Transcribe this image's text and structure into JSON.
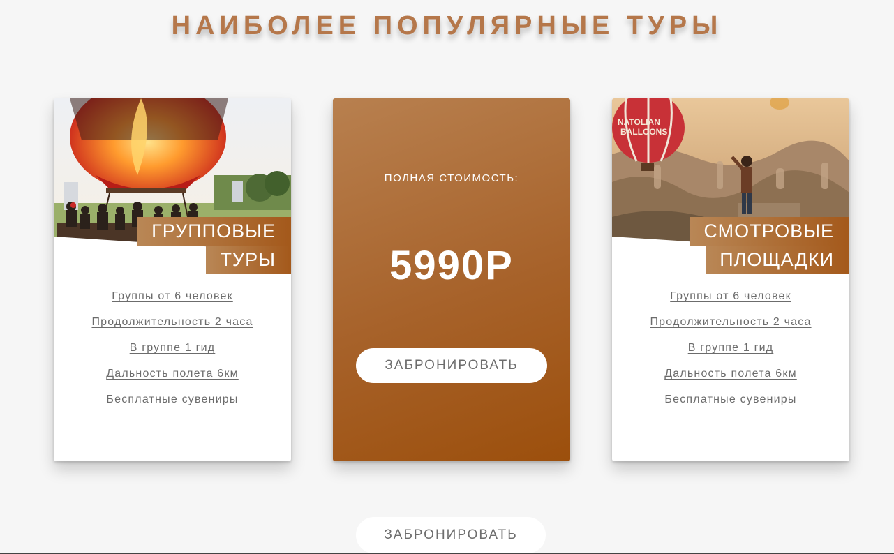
{
  "section": {
    "title": "НАИБОЛЕЕ ПОПУЛЯРНЫЕ ТУРЫ"
  },
  "cards": [
    {
      "label_line1": "ГРУППОВЫЕ",
      "label_line2": "ТУРЫ",
      "features": [
        "Группы от 6 человек",
        "Продолжительность 2 часа",
        "В группе 1 гид",
        "Дальность полета 6км",
        "Бесплатные сувениры"
      ]
    },
    {
      "price_caption": "ПОЛНАЯ СТОИМОСТЬ:",
      "price": "5990Р",
      "button_label": "ЗАБРОНИРОВАТЬ"
    },
    {
      "label_line1": "СМОТРОВЫЕ",
      "label_line2": "ПЛОЩАДКИ",
      "features": [
        "Группы от 6 человек",
        "Продолжительность 2 часа",
        "В группе 1 гид",
        "Дальность полета 6км",
        "Бесплатные сувениры"
      ]
    }
  ],
  "balloon_text": "NATOLIAN BALLOONS",
  "bottom_button": {
    "label": "ЗАБРОНИРОВАТЬ"
  },
  "colors": {
    "accent_start": "#b98756",
    "accent_end": "#9c4f0c",
    "title": "#b5774a",
    "feature_text": "#6c6c6c",
    "background": "#f6f6f6"
  }
}
